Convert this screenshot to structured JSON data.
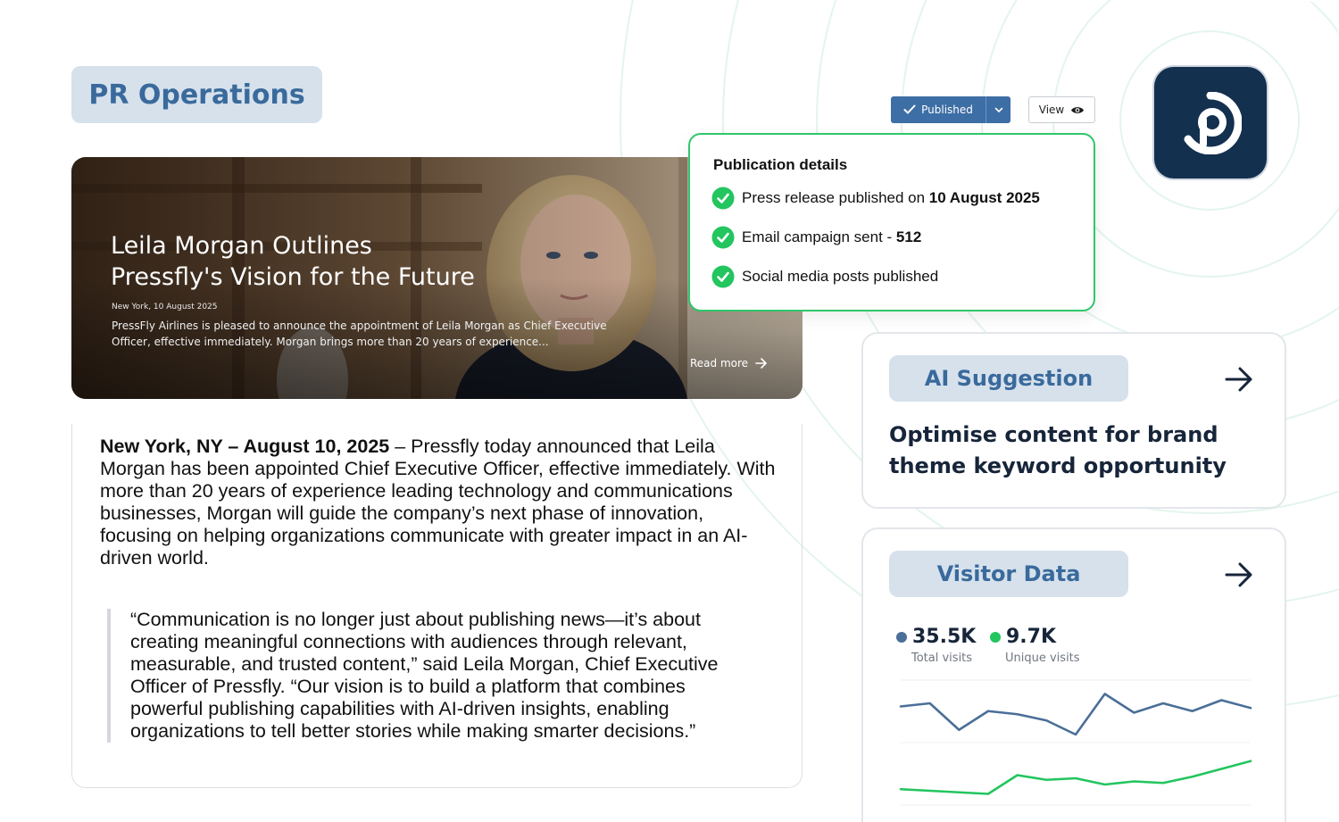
{
  "header": {
    "tag": "PR Operations"
  },
  "hero": {
    "title_line1": "Leila Morgan Outlines",
    "title_line2": "Pressfly's Vision for the Future",
    "date": "New York, 10 August 2025",
    "description": "PressFly Airlines is pleased to announce the appointment of Leila Morgan as Chief Executive Officer, effective immediately. Morgan brings more than 20 years of experience...",
    "read_more": "Read more"
  },
  "article": {
    "dateline": "New York, NY – August 10, 2025",
    "lead": " – Pressfly today announced that Leila Morgan has been appointed Chief Executive Officer, effective immediately. With more than 20 years of experience leading technology and communications businesses, Morgan will guide the company’s next phase of innovation, focusing on helping organizations communicate with greater impact in an AI-driven world.",
    "quote": "“Communication is no longer just about publishing news—it’s about creating meaningful connections with audiences through relevant, measurable, and trusted content,” said Leila Morgan, Chief Executive Officer of Pressfly. “Our vision is to build a platform that combines powerful publishing capabilities with AI-driven insights, enabling organizations to tell better stories while making smarter decisions.”"
  },
  "toolbar": {
    "published_label": "Published",
    "view_label": "View"
  },
  "publication": {
    "title": "Publication details",
    "items": [
      {
        "text": "Press release published on ",
        "bold": "10 August 2025"
      },
      {
        "text": "Email campaign sent - ",
        "bold": "512"
      },
      {
        "text": "Social media posts published",
        "bold": ""
      }
    ]
  },
  "ai_card": {
    "tag": "AI Suggestion",
    "text": "Optimise content for brand theme keyword opportunity"
  },
  "visitor_card": {
    "tag": "Visitor Data",
    "stats": [
      {
        "value": "35.5K",
        "label": "Total visits",
        "color": "#4a6f98"
      },
      {
        "value": "9.7K",
        "label": "Unique visits",
        "color": "#22c55e"
      }
    ]
  },
  "chart_data": {
    "type": "line",
    "x": [
      0,
      1,
      2,
      3,
      4,
      5,
      6,
      7,
      8,
      9,
      10,
      11,
      12
    ],
    "series": [
      {
        "values": [
          62,
          64,
          47,
          59,
          57,
          53,
          44,
          70,
          58,
          64,
          59,
          66,
          61
        ],
        "color": "#4a6f98"
      },
      {
        "values": [
          9,
          8,
          7,
          6,
          18,
          15,
          16,
          12,
          14,
          13,
          17,
          22,
          27
        ],
        "color": "#22c55e"
      }
    ],
    "ylim": [
      0,
      80
    ],
    "grid": true,
    "colors": {
      "accent": "#3d6ea5",
      "success": "#2ec76a",
      "tag_bg": "#d6e1ec"
    }
  }
}
